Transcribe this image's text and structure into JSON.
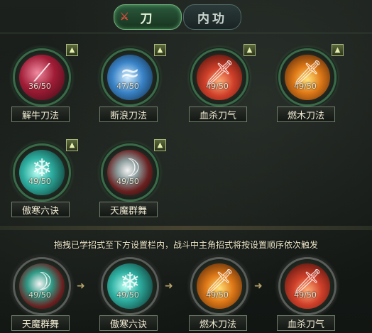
{
  "tabs": [
    {
      "label": "刀",
      "active": true
    },
    {
      "label": "内功",
      "active": false
    }
  ],
  "skills": [
    {
      "name": "解牛刀法",
      "level": "36/50",
      "icon": "blade-slash-icon",
      "color": "#c0304a"
    },
    {
      "name": "断浪刀法",
      "level": "47/50",
      "icon": "wave-blade-icon",
      "color": "#3a84c8"
    },
    {
      "name": "血杀刀气",
      "level": "49/50",
      "icon": "blood-blade-icon",
      "color": "#d0402a"
    },
    {
      "name": "燃木刀法",
      "level": "49/50",
      "icon": "fire-blade-icon",
      "color": "#e07a18"
    },
    {
      "name": "傲寒六诀",
      "level": "49/50",
      "icon": "frost-blade-icon",
      "color": "#2fb0a2"
    },
    {
      "name": "天魔群舞",
      "level": "49/50",
      "icon": "demon-dance-icon",
      "color": "#7a3a3a"
    }
  ],
  "instruction": "拖拽已学招式至下方设置栏内，战斗中主角招式将按设置顺序依次触发",
  "sequence": [
    {
      "name": "天魔群舞",
      "level": "49/50",
      "icon": "demon-dance-icon",
      "color": "#2f9a86"
    },
    {
      "name": "傲寒六诀",
      "level": "49/50",
      "icon": "frost-blade-icon",
      "color": "#2f9a86"
    },
    {
      "name": "燃木刀法",
      "level": "49/50",
      "icon": "fire-blade-icon",
      "color": "#e07a18"
    },
    {
      "name": "血杀刀气",
      "level": "49/50",
      "icon": "blood-blade-icon",
      "color": "#d0402a"
    }
  ],
  "upgrade_symbol": "▲",
  "arrow_symbol": "➜"
}
